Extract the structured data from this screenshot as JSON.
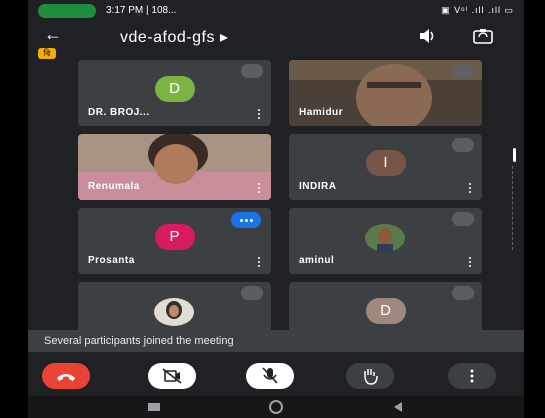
{
  "status_bar": {
    "time": "3:17 PM | 108...",
    "system_icons": "▣ Vᵒˡ .ıll .ıll ▭"
  },
  "header": {
    "title": "vde-afod-gfs ▸",
    "back_icon": "arrow-left-icon",
    "audio_icon": "speaker-icon",
    "camera_icon": "camera-switch-icon"
  },
  "badge": {
    "label": "বি"
  },
  "participants": [
    {
      "name": "DR. BROJ...",
      "initial": "D",
      "avatar_color": "#7cb342",
      "muted": true
    },
    {
      "name": "Hamidur",
      "initial": "",
      "avatar_color": "",
      "muted": true
    },
    {
      "name": "Renumala",
      "initial": "",
      "avatar_color": "",
      "muted": false
    },
    {
      "name": "INDIRA",
      "initial": "I",
      "avatar_color": "#795548",
      "muted": true
    },
    {
      "name": "Prosanta",
      "initial": "P",
      "avatar_color": "#d81b60",
      "muted": false,
      "speaking": true
    },
    {
      "name": "aminul",
      "initial": "",
      "avatar_color": "",
      "muted": true
    },
    {
      "name": "",
      "initial": "",
      "avatar_color": "",
      "muted": true
    },
    {
      "name": "",
      "initial": "D",
      "avatar_color": "#a1887f",
      "muted": true
    }
  ],
  "toast": {
    "message": "Several participants joined the meeting"
  },
  "controls": {
    "end_call": "end-call-icon",
    "camera": "camera-off-icon",
    "mic": "mic-off-icon",
    "hand": "raise-hand-icon",
    "more": "more-options-icon"
  },
  "colors": {
    "end_call": "#ea4335",
    "tile": "#3c4043",
    "background": "#202124",
    "speaking": "#1a73e8"
  }
}
